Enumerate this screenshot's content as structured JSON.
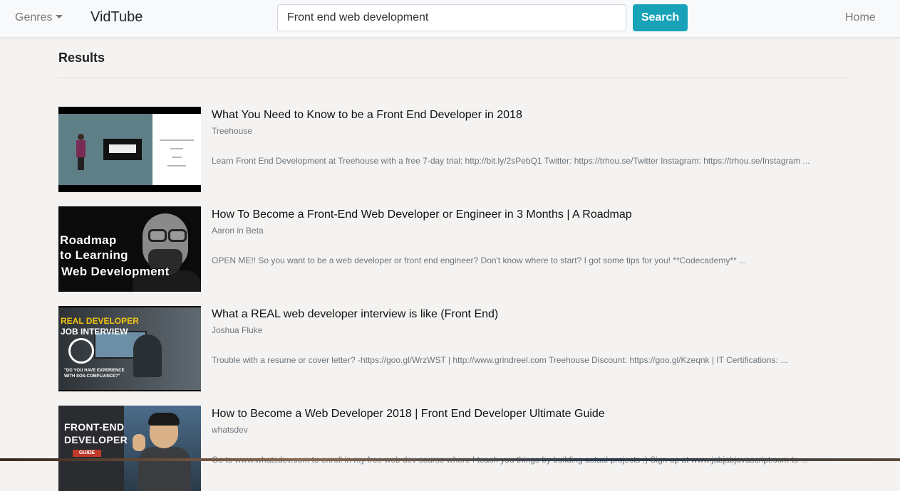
{
  "navbar": {
    "genres_label": "Genres",
    "brand": "VidTube",
    "search_value": "Front end web development",
    "search_button": "Search",
    "home_label": "Home",
    "accent_color": "#17a2b8"
  },
  "results": {
    "heading": "Results",
    "items": [
      {
        "title": "What You Need to Know to be a Front End Developer in 2018",
        "channel": "Treehouse",
        "description": "Learn Front End Development at Treehouse with a free 7-day trial: http://bit.ly/2sPebQ1 Twitter: https://trhou.se/Twitter Instagram: https://trhou.se/Instagram ..."
      },
      {
        "title": "How To Become a Front-End Web Developer or Engineer in 3 Months | A Roadmap",
        "channel": "Aaron in Beta",
        "description": "OPEN ME!! So you want to be a web developer or front end engineer? Don't know where to start? I got some tips for you! **Codecademy** ...",
        "thumb_text": [
          "Roadmap",
          "to Learning",
          "Web Development"
        ]
      },
      {
        "title": "What a REAL web developer interview is like (Front End)",
        "channel": "Joshua Fluke",
        "description": "Trouble with a resume or cover letter? -https://goo.gl/WrzWST | http://www.grindreel.com Treehouse Discount: https://goo.gl/Kzeqnk | IT Certifications: ...",
        "thumb_text": [
          "REAL DEVELOPER",
          "JOB INTERVIEW",
          "\"DO YOU HAVE EXPERIENCE",
          "WITH SOS-COMPLIANCE?\""
        ]
      },
      {
        "title": "How to Become a Web Developer 2018 | Front End Developer Ultimate Guide",
        "channel": "whatsdev",
        "description": "Go to www.whatsdev.com to enroll in my free web dev course where I teach you things by building actual projects :)  Sign up at www.jabjabjavascript.com to ...",
        "thumb_text": [
          "FRONT-END",
          "DEVELOPER",
          "GUIDE"
        ]
      }
    ]
  }
}
